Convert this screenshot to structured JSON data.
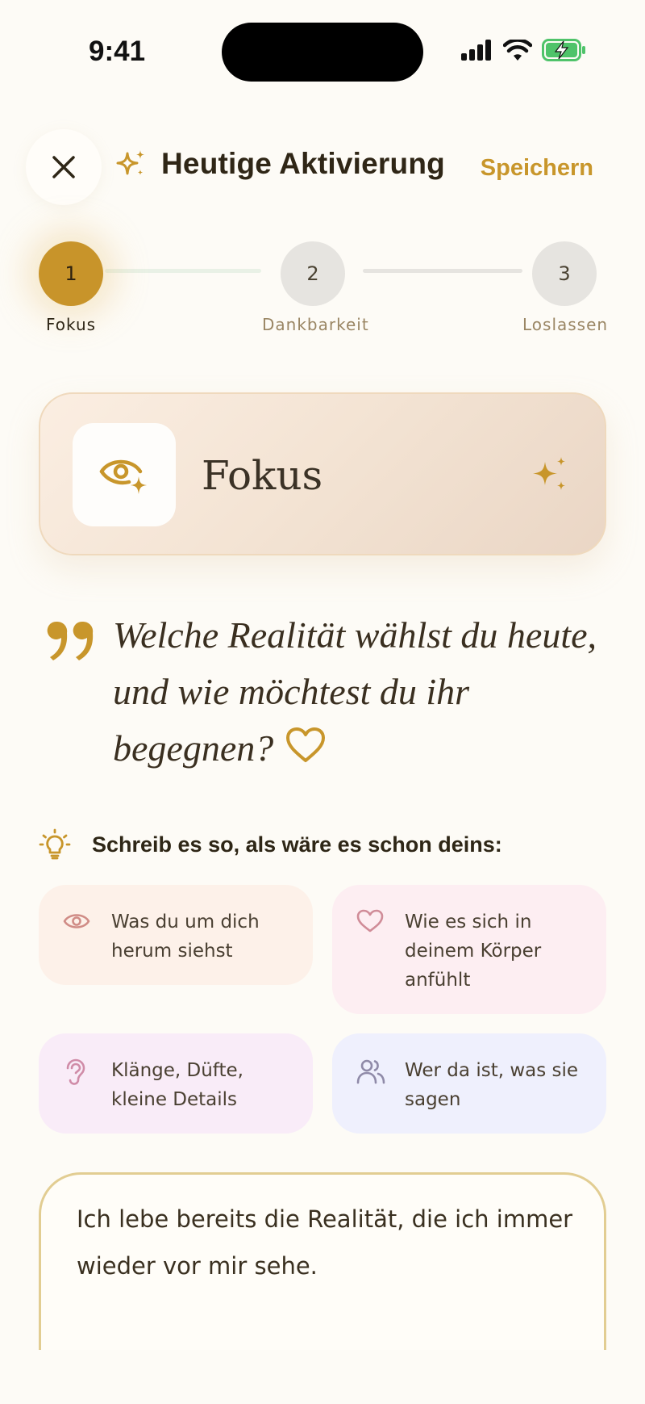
{
  "status_bar": {
    "time": "9:41"
  },
  "header": {
    "title": "Heutige Aktivierung",
    "save_label": "Speichern"
  },
  "stepper": {
    "steps": [
      {
        "number": "1",
        "label": "Fokus",
        "state": "active"
      },
      {
        "number": "2",
        "label": "Dankbarkeit",
        "state": "upcoming"
      },
      {
        "number": "3",
        "label": "Loslassen",
        "state": "upcoming"
      }
    ]
  },
  "focus_card": {
    "title": "Fokus",
    "icon": "eye-sparkle-icon"
  },
  "prompt": {
    "question": "Welche Realität wählst du heute, und wie möchtest du ihr begegnen?"
  },
  "hint": {
    "title": "Schreib es so, als wäre es schon deins:",
    "chips": [
      {
        "icon": "eye-icon",
        "text": "Was du um dich herum siehst"
      },
      {
        "icon": "heart-icon",
        "text": "Wie es sich in deinem Körper anfühlt"
      },
      {
        "icon": "ear-icon",
        "text": "Klänge, Düfte, kleine Details"
      },
      {
        "icon": "people-icon",
        "text": "Wer da ist, was sie sagen"
      }
    ]
  },
  "journal": {
    "value": "Ich lebe bereits die Realität, die ich immer wieder vor mir sehe."
  },
  "colors": {
    "accent": "#c8962b",
    "background": "#fdfbf6",
    "text": "#2e261a"
  }
}
